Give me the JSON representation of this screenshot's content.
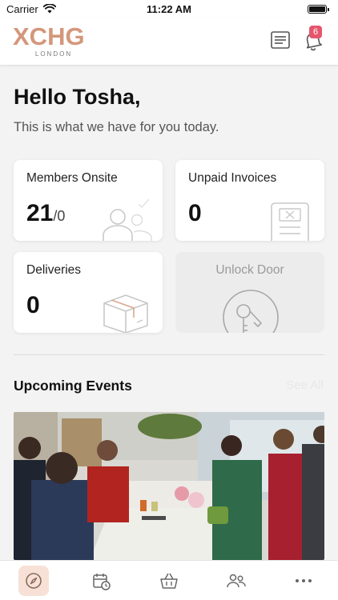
{
  "status_bar": {
    "carrier": "Carrier",
    "time": "11:22 AM",
    "icons": [
      "wifi-icon",
      "battery-icon"
    ]
  },
  "header": {
    "logo_text": "XCHG",
    "logo_subtext": "LONDON",
    "icons": [
      "newspaper-icon",
      "bell-icon"
    ],
    "notification_count": "6",
    "brand_color": "#d4977b",
    "badge_color": "#e5566d"
  },
  "greeting": {
    "title": "Hello Tosha,",
    "subtitle": "This is what we have for you today."
  },
  "cards": {
    "members_onsite": {
      "label": "Members Onsite",
      "value": "21",
      "suffix": "/0",
      "icon": "people-icon"
    },
    "unpaid_invoices": {
      "label": "Unpaid Invoices",
      "value": "0",
      "icon": "invoice-icon"
    },
    "deliveries": {
      "label": "Deliveries",
      "value": "0",
      "icon": "package-icon"
    },
    "unlock_door": {
      "label": "Unlock Door",
      "icon": "key-icon",
      "state": "disabled"
    }
  },
  "events": {
    "section_title": "Upcoming Events",
    "see_all_label": "See All",
    "photo": "event-photo"
  },
  "tab_bar": {
    "tabs": [
      {
        "name": "explore",
        "icon": "compass-icon",
        "active": true
      },
      {
        "name": "bookings",
        "icon": "calendar-clock-icon",
        "active": false
      },
      {
        "name": "shop",
        "icon": "basket-icon",
        "active": false
      },
      {
        "name": "community",
        "icon": "people-icon",
        "active": false
      },
      {
        "name": "more",
        "icon": "more-icon",
        "active": false
      }
    ],
    "active_color": "#f7e1d6"
  }
}
